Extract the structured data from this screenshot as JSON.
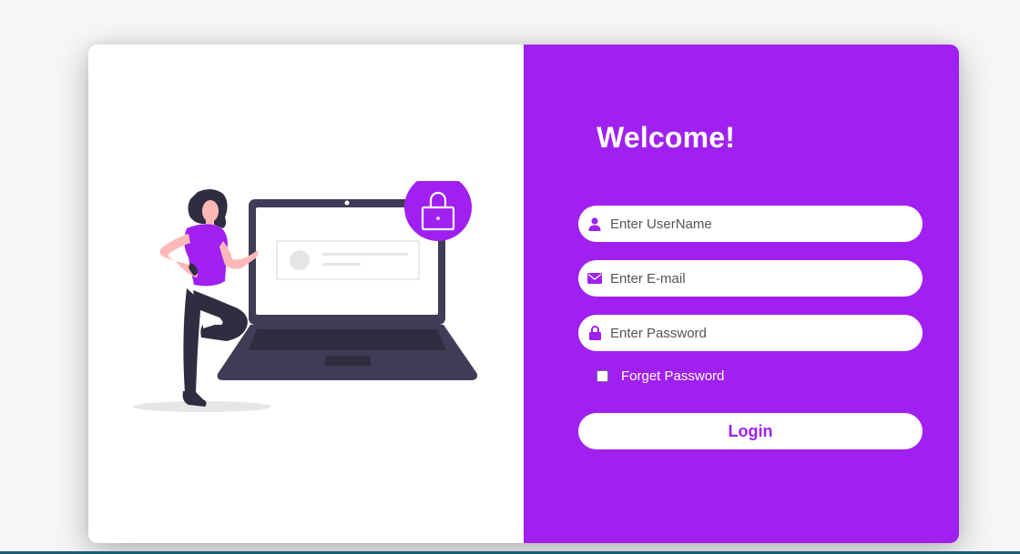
{
  "colors": {
    "accent": "#a020f0",
    "dark": "#3f3d56",
    "skin": "#ffb8b8",
    "white": "#ffffff"
  },
  "illustration": {
    "name": "woman-with-laptop-lock",
    "icons": [
      "lock-icon"
    ]
  },
  "form": {
    "title": "Welcome!",
    "username": {
      "placeholder": "Enter UserName",
      "value": "",
      "icon": "user-icon"
    },
    "email": {
      "placeholder": "Enter E-mail",
      "value": "",
      "icon": "envelope-icon"
    },
    "password": {
      "placeholder": "Enter Password",
      "value": "",
      "icon": "lock-icon"
    },
    "forget_label": "Forget Password",
    "forget_checked": false,
    "login_label": "Login"
  }
}
